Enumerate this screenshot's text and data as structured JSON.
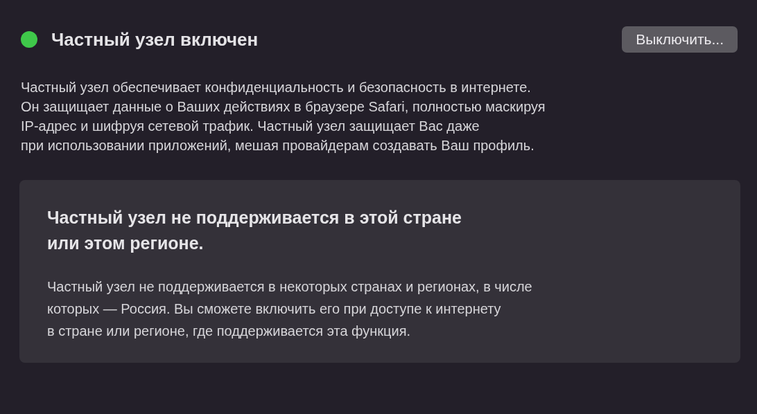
{
  "status": {
    "title": "Частный узел включен",
    "on": true
  },
  "button": {
    "label": "Выключить..."
  },
  "description": "Частный узел обеспечивает конфиденциальность и безопасность в интернете.\nОн защищает данные о Ваших действиях в браузере Safari, полностью маскируя\nIP-адрес и шифруя сетевой трафик. Частный узел защищает Вас даже\nпри использовании приложений, мешая провайдерам создавать Ваш профиль.",
  "notice": {
    "title": "Частный узел не поддерживается в этой стране\nили этом регионе.",
    "body": "Частный узел не поддерживается в некоторых странах и регионах, в числе\nкоторых — Россия. Вы сможете включить его при доступе к интернету\nв стране или регионе, где поддерживается эта функция."
  }
}
